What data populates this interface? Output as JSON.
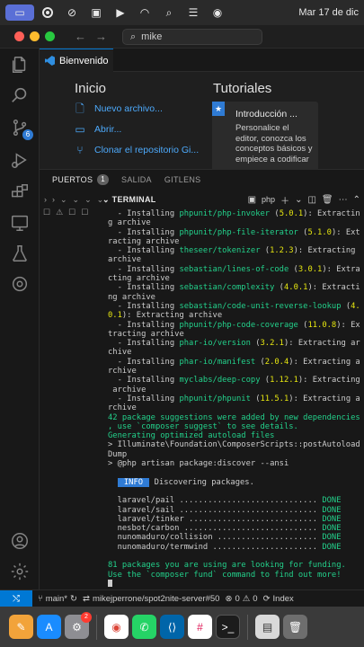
{
  "menubar": {
    "date_label": "Mar 17 de dic"
  },
  "window": {
    "search_text": "mike"
  },
  "tabs": [
    {
      "label": "Bienvenido"
    }
  ],
  "welcome": {
    "start_heading": "Inicio",
    "tutorials_heading": "Tutoriales",
    "links": [
      {
        "label": "Nuevo archivo...",
        "icon": "new-file-icon"
      },
      {
        "label": "Abrir...",
        "icon": "folder-open-icon"
      },
      {
        "label": "Clonar el repositorio Gi...",
        "icon": "git-clone-icon"
      }
    ],
    "tutorial": {
      "title": "Introducción ...",
      "description": "Personalice el editor, conozca los conceptos básicos y empiece a codificar"
    }
  },
  "panel": {
    "tabs": [
      {
        "label": "PUERTOS",
        "count": "1"
      },
      {
        "label": "SALIDA"
      },
      {
        "label": "GITLENS"
      }
    ],
    "terminal_label": "TERMINAL",
    "shell_label": "php"
  },
  "terminal": {
    "lines": [
      {
        "parts": [
          {
            "t": "  - Installing "
          },
          {
            "t": "phpunit/php-invoker",
            "c": "pkg"
          },
          {
            "t": " ("
          },
          {
            "t": "5.0.1",
            "c": "ver"
          },
          {
            "t": "): Extractin"
          }
        ]
      },
      {
        "parts": [
          {
            "t": "g archive"
          }
        ]
      },
      {
        "parts": [
          {
            "t": "  - Installing "
          },
          {
            "t": "phpunit/php-file-iterator",
            "c": "pkg"
          },
          {
            "t": " ("
          },
          {
            "t": "5.1.0",
            "c": "ver"
          },
          {
            "t": "): Ext"
          }
        ]
      },
      {
        "parts": [
          {
            "t": "racting archive"
          }
        ]
      },
      {
        "parts": [
          {
            "t": "  - Installing "
          },
          {
            "t": "theseer/tokenizer",
            "c": "pkg"
          },
          {
            "t": " ("
          },
          {
            "t": "1.2.3",
            "c": "ver"
          },
          {
            "t": "): Extracting"
          }
        ]
      },
      {
        "parts": [
          {
            "t": "archive"
          }
        ]
      },
      {
        "parts": [
          {
            "t": "  - Installing "
          },
          {
            "t": "sebastian/lines-of-code",
            "c": "pkg"
          },
          {
            "t": " ("
          },
          {
            "t": "3.0.1",
            "c": "ver"
          },
          {
            "t": "): Extra"
          }
        ]
      },
      {
        "parts": [
          {
            "t": "cting archive"
          }
        ]
      },
      {
        "parts": [
          {
            "t": "  - Installing "
          },
          {
            "t": "sebastian/complexity",
            "c": "pkg"
          },
          {
            "t": " ("
          },
          {
            "t": "4.0.1",
            "c": "ver"
          },
          {
            "t": "): Extracti"
          }
        ]
      },
      {
        "parts": [
          {
            "t": "ng archive"
          }
        ]
      },
      {
        "parts": [
          {
            "t": "  - Installing "
          },
          {
            "t": "sebastian/code-unit-reverse-lookup",
            "c": "pkg"
          },
          {
            "t": " ("
          },
          {
            "t": "4.",
            "c": "ver"
          }
        ]
      },
      {
        "parts": [
          {
            "t": "0.1",
            "c": "ver"
          },
          {
            "t": "): Extracting archive"
          }
        ]
      },
      {
        "parts": [
          {
            "t": "  - Installing "
          },
          {
            "t": "phpunit/php-code-coverage",
            "c": "pkg"
          },
          {
            "t": " ("
          },
          {
            "t": "11.0.8",
            "c": "ver"
          },
          {
            "t": "): Ex"
          }
        ]
      },
      {
        "parts": [
          {
            "t": "tracting archive"
          }
        ]
      },
      {
        "parts": [
          {
            "t": "  - Installing "
          },
          {
            "t": "phar-io/version",
            "c": "pkg"
          },
          {
            "t": " ("
          },
          {
            "t": "3.2.1",
            "c": "ver"
          },
          {
            "t": "): Extracting ar"
          }
        ]
      },
      {
        "parts": [
          {
            "t": "chive"
          }
        ]
      },
      {
        "parts": [
          {
            "t": "  - Installing "
          },
          {
            "t": "phar-io/manifest",
            "c": "pkg"
          },
          {
            "t": " ("
          },
          {
            "t": "2.0.4",
            "c": "ver"
          },
          {
            "t": "): Extracting a"
          }
        ]
      },
      {
        "parts": [
          {
            "t": "rchive"
          }
        ]
      },
      {
        "parts": [
          {
            "t": "  - Installing "
          },
          {
            "t": "myclabs/deep-copy",
            "c": "pkg"
          },
          {
            "t": " ("
          },
          {
            "t": "1.12.1",
            "c": "ver"
          },
          {
            "t": "): Extracting"
          }
        ]
      },
      {
        "parts": [
          {
            "t": " archive"
          }
        ]
      },
      {
        "parts": [
          {
            "t": "  - Installing "
          },
          {
            "t": "phpunit/phpunit",
            "c": "pkg"
          },
          {
            "t": " ("
          },
          {
            "t": "11.5.1",
            "c": "ver"
          },
          {
            "t": "): Extracting a"
          }
        ]
      },
      {
        "parts": [
          {
            "t": "rchive"
          }
        ]
      },
      {
        "parts": [
          {
            "t": "42 package suggestions were added by new dependencies",
            "c": "grn"
          }
        ]
      },
      {
        "parts": [
          {
            "t": ", use `composer suggest` to see details.",
            "c": "grn"
          }
        ]
      },
      {
        "parts": [
          {
            "t": "Generating optimized autoload files",
            "c": "grn"
          }
        ]
      },
      {
        "parts": [
          {
            "t": "> Illuminate\\Foundation\\ComposerScripts::postAutoload"
          }
        ]
      },
      {
        "parts": [
          {
            "t": "Dump"
          }
        ]
      },
      {
        "parts": [
          {
            "t": "> @php artisan package:discover --ansi"
          }
        ]
      },
      {
        "parts": [
          {
            "t": ""
          }
        ]
      },
      {
        "parts": [
          {
            "t": "  "
          },
          {
            "t": " INFO ",
            "c": "info-badge"
          },
          {
            "t": " Discovering packages."
          }
        ]
      },
      {
        "parts": [
          {
            "t": ""
          }
        ]
      },
      {
        "parts": [
          {
            "t": "  laravel/pail ............................. "
          },
          {
            "t": "DONE",
            "c": "grn"
          }
        ]
      },
      {
        "parts": [
          {
            "t": "  laravel/sail ............................. "
          },
          {
            "t": "DONE",
            "c": "grn"
          }
        ]
      },
      {
        "parts": [
          {
            "t": "  laravel/tinker ........................... "
          },
          {
            "t": "DONE",
            "c": "grn"
          }
        ]
      },
      {
        "parts": [
          {
            "t": "  nesbot/carbon ............................ "
          },
          {
            "t": "DONE",
            "c": "grn"
          }
        ]
      },
      {
        "parts": [
          {
            "t": "  nunomaduro/collision ..................... "
          },
          {
            "t": "DONE",
            "c": "grn"
          }
        ]
      },
      {
        "parts": [
          {
            "t": "  nunomaduro/termwind ...................... "
          },
          {
            "t": "DONE",
            "c": "grn"
          }
        ]
      },
      {
        "parts": [
          {
            "t": ""
          }
        ]
      },
      {
        "parts": [
          {
            "t": "81 packages you are using are looking for funding.",
            "c": "grn"
          }
        ]
      },
      {
        "parts": [
          {
            "t": "Use the `composer fund` command to find out more!",
            "c": "grn"
          }
        ]
      },
      {
        "parts": [
          {
            "t": "",
            "cursor": true
          }
        ]
      }
    ]
  },
  "statusbar": {
    "branch": "main*",
    "repo": "mikejperrone/spot2nite-server#50",
    "errors": "0",
    "warnings": "0",
    "index_label": "Index"
  },
  "dock": {
    "notification_count": "2"
  },
  "colors": {
    "accent": "#0078d4",
    "link": "#4daafc",
    "terminal_green": "#23d18b",
    "terminal_yellow": "#e5e510"
  }
}
